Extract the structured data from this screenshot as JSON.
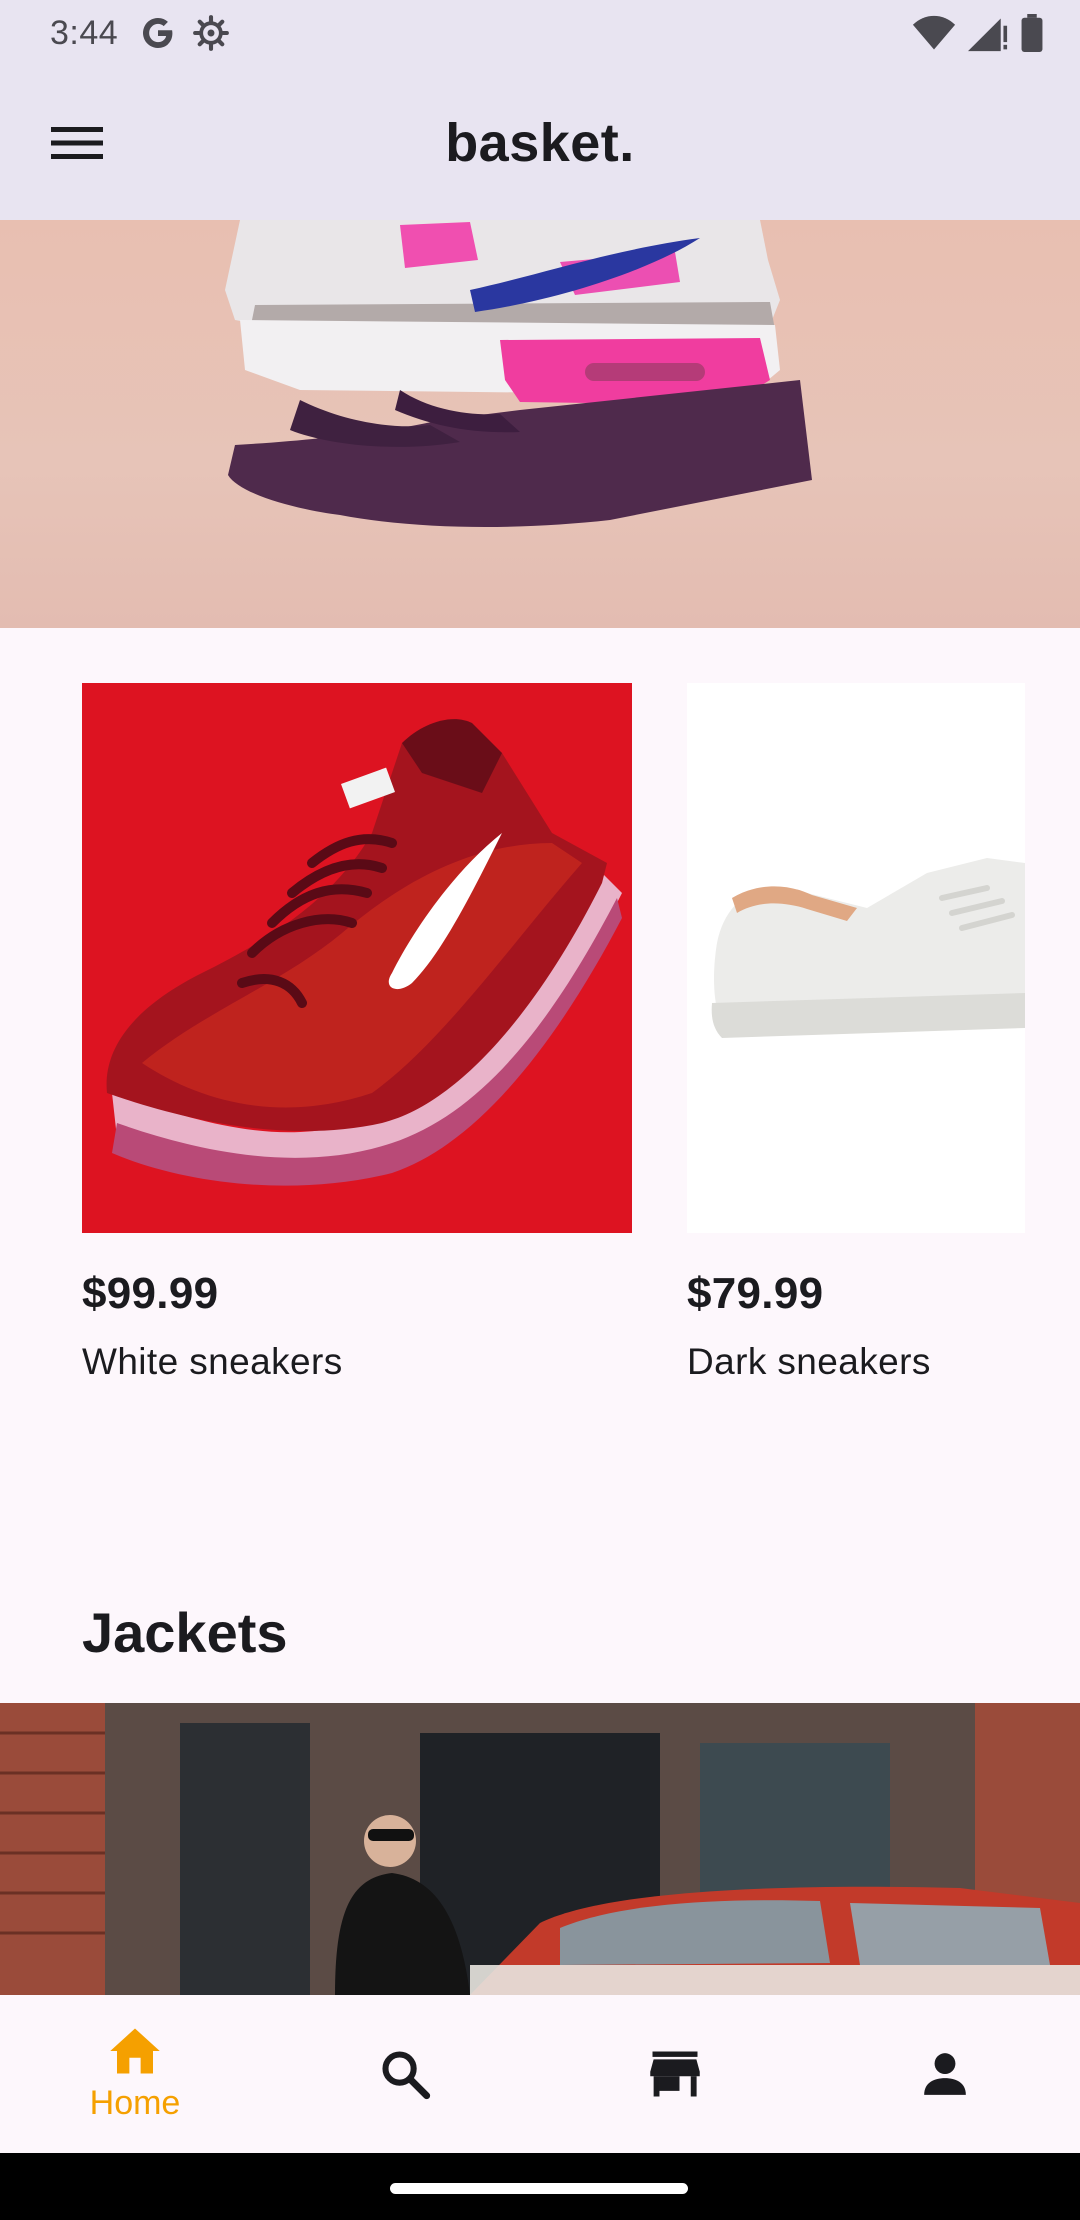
{
  "status_bar": {
    "time": "3:44",
    "left_icons": [
      "google-icon",
      "settings-gear-icon"
    ],
    "right_icons": [
      "wifi-icon",
      "cell-signal-icon",
      "battery-icon"
    ]
  },
  "app_bar": {
    "title": "basket.",
    "menu_icon": "hamburger-menu-icon"
  },
  "products": [
    {
      "price": "$99.99",
      "name": "White sneakers",
      "image": "red nike running shoe"
    },
    {
      "price": "$79.99",
      "name": "Dark sneakers",
      "image": "white leather sneaker"
    }
  ],
  "sections": {
    "jackets_title": "Jackets"
  },
  "bottom_nav": {
    "items": [
      {
        "label": "Home",
        "icon": "home-icon",
        "active": true
      },
      {
        "label": "",
        "icon": "search-icon",
        "active": false
      },
      {
        "label": "",
        "icon": "store-icon",
        "active": false
      },
      {
        "label": "",
        "icon": "person-icon",
        "active": false
      }
    ],
    "active_color": "#f5a000"
  },
  "colors": {
    "app_bar_bg": "#e8e4f1",
    "page_bg": "#fdf7fc",
    "accent": "#f5a000"
  }
}
